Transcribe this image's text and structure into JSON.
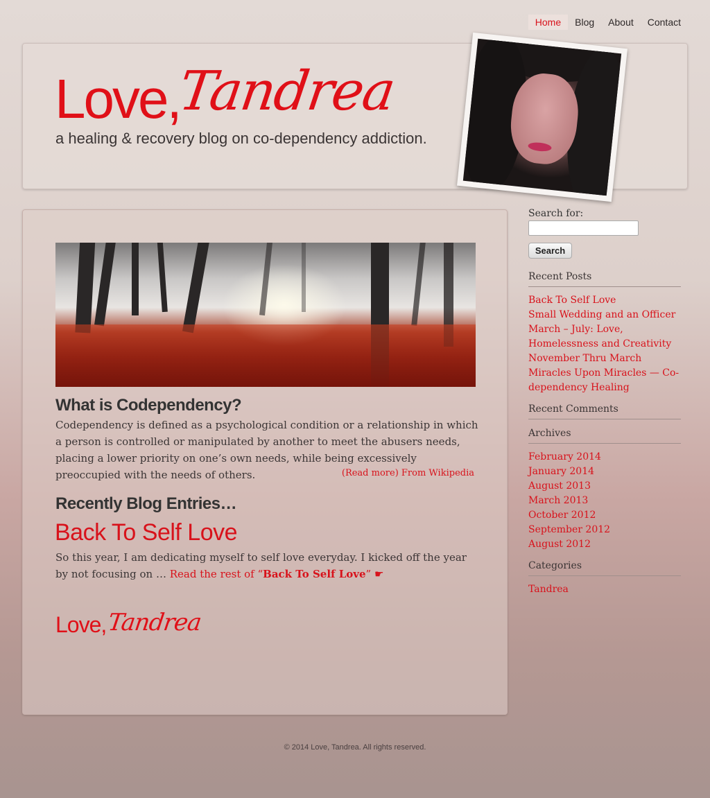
{
  "nav": {
    "items": [
      {
        "label": "Home",
        "active": true
      },
      {
        "label": "Blog",
        "active": false
      },
      {
        "label": "About",
        "active": false
      },
      {
        "label": "Contact",
        "active": false
      }
    ]
  },
  "header": {
    "logo_love": "Love,",
    "logo_script": "Tandrea",
    "tagline": "a healing & recovery blog on co-dependency addiction."
  },
  "main": {
    "heading": "What is Codependency?",
    "definition": "Codependency is defined as a psychological condition or a relationship in which a person is controlled or manipulated by another to meet the abusers needs, placing a lower priority on one’s own needs, while being excessively preoccupied with the needs of others.",
    "read_more": "(Read more) From Wikipedia",
    "recent_heading": "Recently Blog Entries…",
    "post": {
      "title": "Back To Self Love",
      "excerpt": "So this year, I am dedicating myself to self love everyday. I kicked off the year by not focusing on …",
      "read_rest_prefix": "Read the rest of “",
      "read_rest_title": "Back To Self Love",
      "read_rest_suffix": "” ☛"
    },
    "signature_love": "Love,",
    "signature_script": "Tandrea"
  },
  "sidebar": {
    "search_label": "Search for:",
    "search_value": "",
    "search_button": "Search",
    "recent_posts_title": "Recent Posts",
    "recent_posts": [
      "Back To Self Love",
      "Small Wedding and an Officer",
      "March – July: Love, Homelessness and Creativity",
      "November Thru March",
      "Miracles Upon Miracles — Co-dependency Healing"
    ],
    "recent_comments_title": "Recent Comments",
    "archives_title": "Archives",
    "archives": [
      "February 2014",
      "January 2014",
      "August 2013",
      "March 2013",
      "October 2012",
      "September 2012",
      "August 2012"
    ],
    "categories_title": "Categories",
    "categories": [
      "Tandrea"
    ]
  },
  "footer": {
    "copyright": "© 2014 Love, Tandrea. All rights reserved."
  },
  "colors": {
    "accent": "#d8121b",
    "text": "#3a3434"
  }
}
